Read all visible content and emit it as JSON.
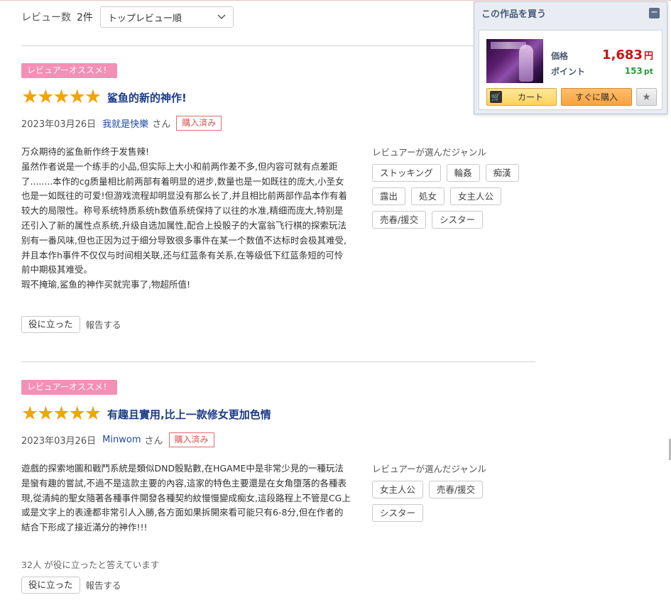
{
  "sort": {
    "label": "レビュー数",
    "count": "2件",
    "selected": "トップレビュー順"
  },
  "buy_box": {
    "title": "この作品を買う",
    "collapse_symbol": "−",
    "price_label": "価格",
    "price_value": "1,683",
    "price_unit": "円",
    "points_label": "ポイント",
    "points_value": "153",
    "points_unit": "pt",
    "cart_label": "カート",
    "buy_now_label": "すぐに購入",
    "favorite_symbol": "★"
  },
  "reviews": [
    {
      "badge": "レビュアーオススメ！",
      "stars": "★★★★★",
      "rating": 5,
      "title": "鲨鱼的新的神作!",
      "date": "2023年03月26日",
      "user": "我就是快樂",
      "san": "さん",
      "purchased": "購入済み",
      "text": "万众期待的鲨鱼新作终于发售辣!\n虽然作者说是一个练手的小品,但实际上大小和前两作差不多,但内容可就有点差距了........本作的cg质量相比前两部有着明显的进步,数量也是一如既往的庞大,小圣女也是一如既往的可爱!但游戏流程却明显没有那么长了,并且相比前两部作品本作有着较大的局限性。称号系统特质系统h数值系统保持了以往的水准,精细而庞大,特别是还引入了新的属性点系统,升级自选加属性,配合上投骰子的大富翁飞行棋的探索玩法别有一番风味,但也正因为过于细分导致很多事件在某一个数值不达标时会极其难受,并且本作h事件不仅仅与时间相关联,还与红蓝条有关系,在等级低下红蓝条短的可怜前中期极其难受。\n瑕不掩瑜,鲨鱼的神作买就完事了,物超所值!",
      "genres_title": "レビュアーが選んだジャンル",
      "genres": [
        "ストッキング",
        "輪姦",
        "痴漢",
        "露出",
        "処女",
        "女主人公",
        "売春/援交",
        "シスター"
      ],
      "helpful_count": "",
      "helpful_button": "役に立った",
      "report": "報告する"
    },
    {
      "badge": "レビュアーオススメ！",
      "stars": "★★★★★",
      "rating": 5,
      "title": "有趣且實用,比上一款修女更加色情",
      "date": "2023年03月26日",
      "user": "Minwom",
      "san": "さん",
      "purchased": "購入済み",
      "text": "遊戲的探索地圖和戰鬥系統是類似DND骰點數,在HGAME中是非常少見的一種玩法是蠻有趣的嘗試,不過不是這款主要的內容,這家的特色主要還是在女角墮落的各種表現,從清純的聖女隨著各種事件開發各種契約紋慢慢變成痴女,這段路程上不管是CG上或是文字上的表達都非常引人入勝,各方面如果拆開來看可能只有6-8分,但在作者的結合下形成了接近滿分的神作!!!",
      "genres_title": "レビュアーが選んだジャンル",
      "genres": [
        "女主人公",
        "売春/援交",
        "シスター"
      ],
      "helpful_count": "32人 が役に立ったと答えています",
      "helpful_button": "役に立った",
      "report": "報告する"
    }
  ]
}
